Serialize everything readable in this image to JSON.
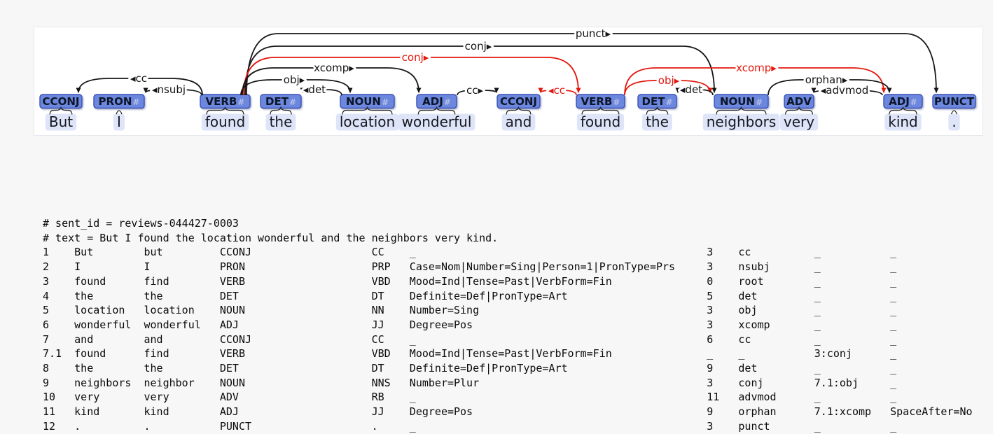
{
  "diagram": {
    "feats_marker": "#",
    "tokens": [
      {
        "id": "1",
        "pos": "CCONJ",
        "word": "But",
        "feats": false
      },
      {
        "id": "2",
        "pos": "PRON",
        "word": "I",
        "feats": true
      },
      {
        "id": "3",
        "pos": "VERB",
        "word": "found",
        "feats": true
      },
      {
        "id": "4",
        "pos": "DET",
        "word": "the",
        "feats": true
      },
      {
        "id": "5",
        "pos": "NOUN",
        "word": "location",
        "feats": true
      },
      {
        "id": "6",
        "pos": "ADJ",
        "word": "wonderful",
        "feats": true
      },
      {
        "id": "7",
        "pos": "CCONJ",
        "word": "and",
        "feats": false
      },
      {
        "id": "7.1",
        "pos": "VERB",
        "word": "found",
        "feats": true
      },
      {
        "id": "8",
        "pos": "DET",
        "word": "the",
        "feats": true
      },
      {
        "id": "9",
        "pos": "NOUN",
        "word": "neighbors",
        "feats": true
      },
      {
        "id": "10",
        "pos": "ADV",
        "word": "very",
        "feats": false
      },
      {
        "id": "11",
        "pos": "ADJ",
        "word": "kind",
        "feats": true
      },
      {
        "id": "12",
        "pos": "PUNCT",
        "word": ".",
        "feats": false
      }
    ],
    "arcs": [
      {
        "label": "punct",
        "head": "3",
        "dep": "12",
        "enhanced": false
      },
      {
        "label": "conj",
        "head": "3",
        "dep": "9",
        "enhanced": false
      },
      {
        "label": "conj",
        "head": "3",
        "dep": "7.1",
        "enhanced": true
      },
      {
        "label": "xcomp",
        "head": "3",
        "dep": "6",
        "enhanced": false
      },
      {
        "label": "obj",
        "head": "3",
        "dep": "5",
        "enhanced": false
      },
      {
        "label": "cc",
        "head": "3",
        "dep": "1",
        "enhanced": false
      },
      {
        "label": "nsubj",
        "head": "3",
        "dep": "2",
        "enhanced": false
      },
      {
        "label": "det",
        "head": "5",
        "dep": "4",
        "enhanced": false
      },
      {
        "label": "cc",
        "head": "6",
        "dep": "7",
        "enhanced": false
      },
      {
        "label": "cc",
        "head": "7.1",
        "dep": "7",
        "enhanced": true
      },
      {
        "label": "obj",
        "head": "7.1",
        "dep": "9",
        "enhanced": true
      },
      {
        "label": "det",
        "head": "9",
        "dep": "8",
        "enhanced": false
      },
      {
        "label": "xcomp",
        "head": "7.1",
        "dep": "11",
        "enhanced": true
      },
      {
        "label": "orphan",
        "head": "9",
        "dep": "11",
        "enhanced": false
      },
      {
        "label": "advmod",
        "head": "11",
        "dep": "10",
        "enhanced": false
      }
    ],
    "colors": {
      "arc_basic": "#151515",
      "arc_enhanced": "#e3170c",
      "box_fill": "#6c87de",
      "box_border": "#3a4fb4",
      "box_text": "#0d1526",
      "feats_hash": "#c5cbe8",
      "word_text": "#17171f",
      "word_bg": "#dfe5f9",
      "brace": "#222222"
    }
  },
  "conllu": {
    "comments": [
      "# sent_id = reviews-044427-0003",
      "# text = But I found the location wonderful and the neighbors very kind."
    ],
    "rows": [
      [
        "1",
        "But",
        "but",
        "CCONJ",
        "CC",
        "_",
        "3",
        "cc",
        "_",
        "_"
      ],
      [
        "2",
        "I",
        "I",
        "PRON",
        "PRP",
        "Case=Nom|Number=Sing|Person=1|PronType=Prs",
        "3",
        "nsubj",
        "_",
        "_"
      ],
      [
        "3",
        "found",
        "find",
        "VERB",
        "VBD",
        "Mood=Ind|Tense=Past|VerbForm=Fin",
        "0",
        "root",
        "_",
        "_"
      ],
      [
        "4",
        "the",
        "the",
        "DET",
        "DT",
        "Definite=Def|PronType=Art",
        "5",
        "det",
        "_",
        "_"
      ],
      [
        "5",
        "location",
        "location",
        "NOUN",
        "NN",
        "Number=Sing",
        "3",
        "obj",
        "_",
        "_"
      ],
      [
        "6",
        "wonderful",
        "wonderful",
        "ADJ",
        "JJ",
        "Degree=Pos",
        "3",
        "xcomp",
        "_",
        "_"
      ],
      [
        "7",
        "and",
        "and",
        "CCONJ",
        "CC",
        "_",
        "6",
        "cc",
        "_",
        "_"
      ],
      [
        "7.1",
        "found",
        "find",
        "VERB",
        "VBD",
        "Mood=Ind|Tense=Past|VerbForm=Fin",
        "_",
        "_",
        "3:conj",
        "_"
      ],
      [
        "8",
        "the",
        "the",
        "DET",
        "DT",
        "Definite=Def|PronType=Art",
        "9",
        "det",
        "_",
        "_"
      ],
      [
        "9",
        "neighbors",
        "neighbor",
        "NOUN",
        "NNS",
        "Number=Plur",
        "3",
        "conj",
        "7.1:obj",
        "_"
      ],
      [
        "10",
        "very",
        "very",
        "ADV",
        "RB",
        "_",
        "11",
        "advmod",
        "_",
        "_"
      ],
      [
        "11",
        "kind",
        "kind",
        "ADJ",
        "JJ",
        "Degree=Pos",
        "9",
        "orphan",
        "7.1:xcomp",
        "SpaceAfter=No"
      ],
      [
        "12",
        ".",
        ".",
        "PUNCT",
        ".",
        "_",
        "3",
        "punct",
        "_",
        "_"
      ]
    ]
  }
}
